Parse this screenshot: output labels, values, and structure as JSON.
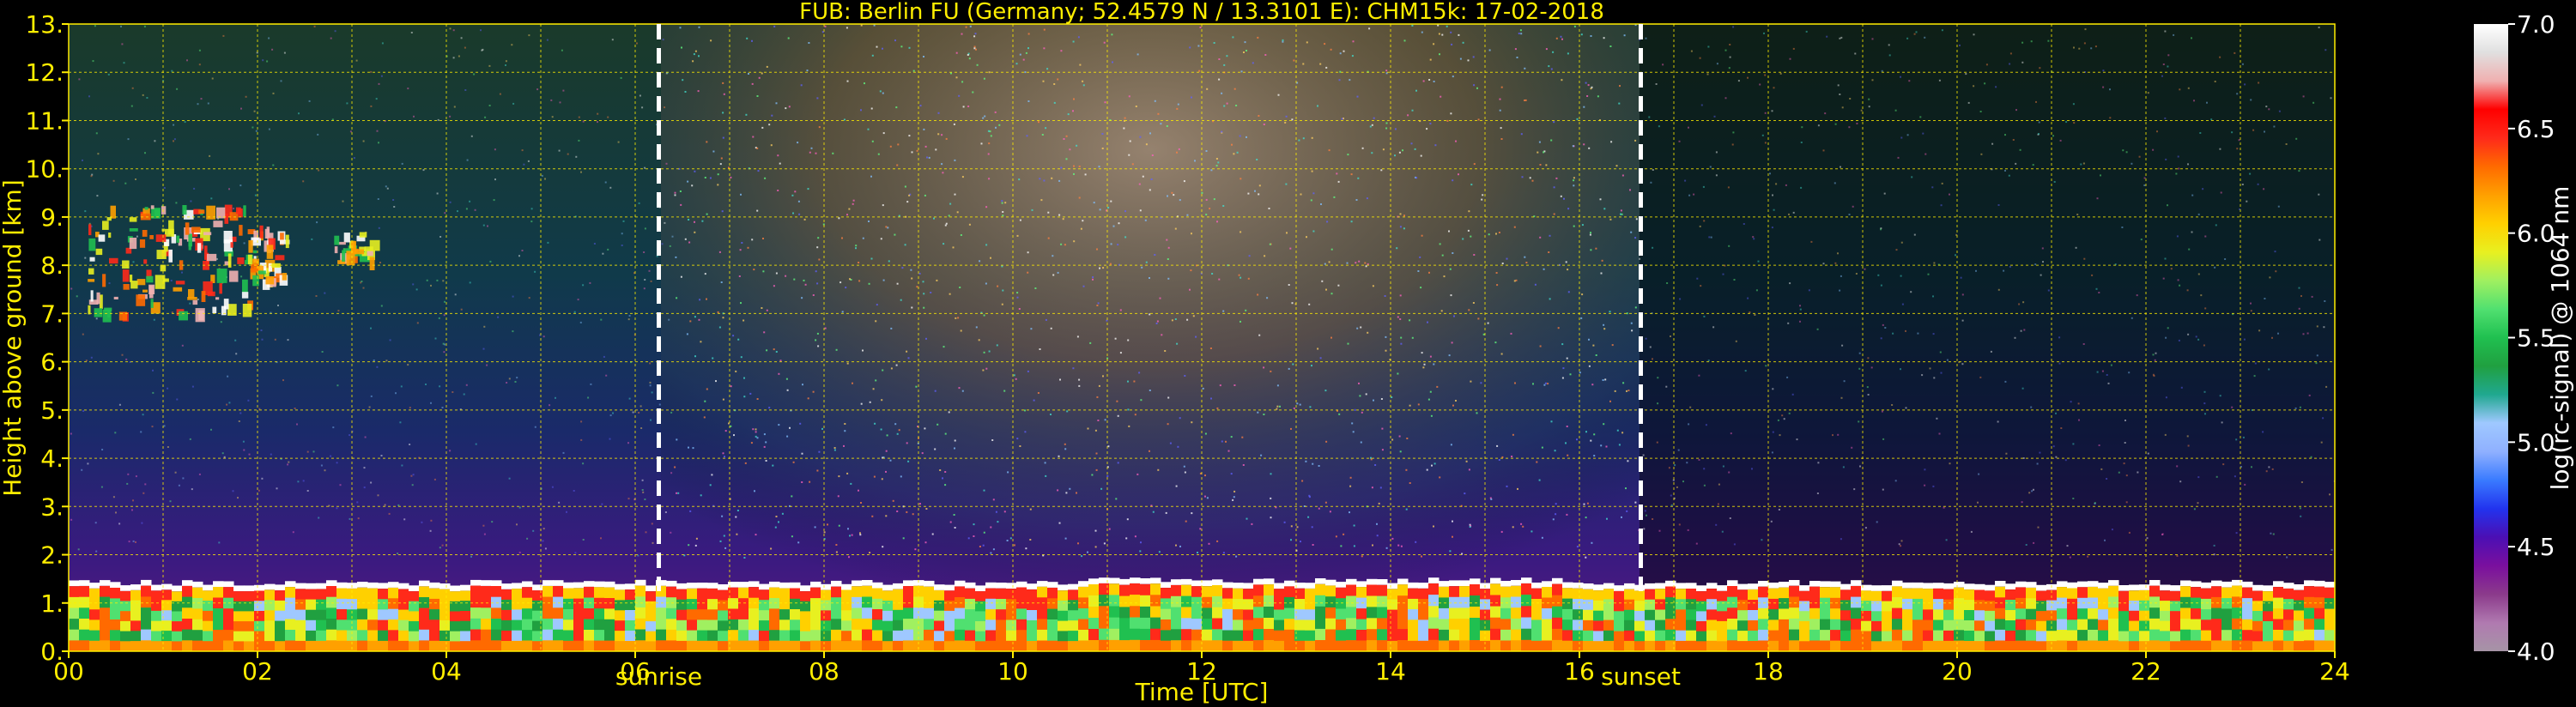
{
  "chart_data": {
    "type": "heatmap",
    "title": "FUB: Berlin FU (Germany; 52.4579 N / 13.3101 E):    CHM15k: 17-02-2018",
    "xlabel": "Time [UTC]",
    "ylabel": "Height above ground [km]",
    "colorbar_label": "log(rc-signal) @ 1064 nm",
    "x_ticks": [
      "00",
      "02",
      "04",
      "06",
      "08",
      "10",
      "12",
      "14",
      "16",
      "18",
      "20",
      "22",
      "24"
    ],
    "y_ticks": [
      "0.",
      "1.",
      "2.",
      "3.",
      "4.",
      "5.",
      "6.",
      "7.",
      "8.",
      "9.",
      "10.",
      "11.",
      "12.",
      "13."
    ],
    "xlim": [
      0,
      24
    ],
    "ylim": [
      0,
      13
    ],
    "colorbar_ticks": [
      "4.0",
      "4.5",
      "5.0",
      "5.5",
      "6.0",
      "6.5",
      "7.0"
    ],
    "colorbar_range": [
      4.0,
      7.0
    ],
    "grid": true,
    "annotations": [
      {
        "label": "sunrise",
        "x": 6.25
      },
      {
        "label": "sunset",
        "x": 16.65
      }
    ],
    "features": {
      "boundary_layer_top_km": 1.3,
      "cirrus_cloud": {
        "time_start": 0.2,
        "time_end": 3.2,
        "height_min_km": 7.0,
        "height_max_km": 9.3
      }
    }
  },
  "colors": {
    "axis_text": "#ffee00",
    "grid": "#ffee00",
    "background": "#000000",
    "colormap": [
      "#a694a6",
      "#b07ab0",
      "#8b3a8b",
      "#7a0f9e",
      "#4b0fb4",
      "#2233ee",
      "#3a7bff",
      "#8fb0ff",
      "#9fc8ff",
      "#20a890",
      "#20a040",
      "#20c050",
      "#50e070",
      "#a0f060",
      "#e8f020",
      "#ffd000",
      "#ffa000",
      "#ff6a00",
      "#ff2a1a",
      "#ff0000",
      "#f0b0b0",
      "#e0e0e0",
      "#ffffff"
    ]
  }
}
